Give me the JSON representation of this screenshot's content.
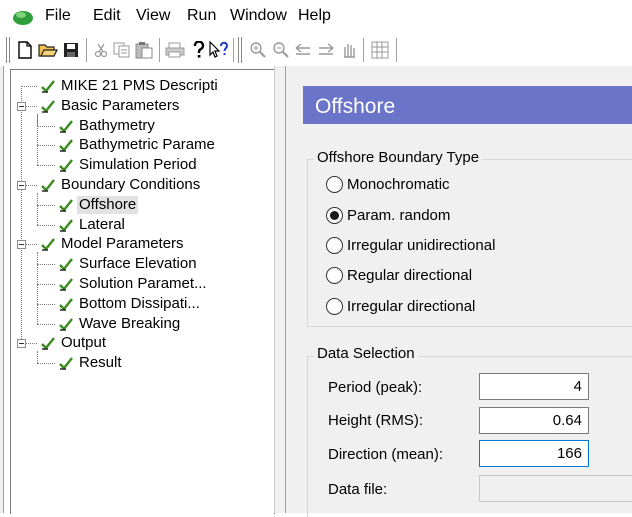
{
  "menu": {
    "items": [
      "File",
      "Edit",
      "View",
      "Run",
      "Window",
      "Help"
    ]
  },
  "toolbar": {
    "buttons": [
      "new-icon",
      "open-icon",
      "save-icon",
      "cut-icon",
      "copy-icon",
      "paste-icon",
      "print-icon",
      "help-icon",
      "context-help-icon",
      "zoom-in-icon",
      "zoom-out-icon",
      "back-icon",
      "forward-icon",
      "pan-icon",
      "grid-icon"
    ]
  },
  "tree": {
    "nodes": [
      {
        "label": "MIKE 21 PMS Descripti",
        "level": 0,
        "checked": true
      },
      {
        "label": "Basic Parameters",
        "level": 0,
        "checked": true,
        "expanded": true
      },
      {
        "label": "Bathymetry",
        "level": 1,
        "checked": true
      },
      {
        "label": "Bathymetric Parame",
        "level": 1,
        "checked": true
      },
      {
        "label": "Simulation Period",
        "level": 1,
        "checked": true
      },
      {
        "label": "Boundary Conditions",
        "level": 0,
        "checked": true,
        "expanded": true
      },
      {
        "label": "Offshore",
        "level": 1,
        "checked": true,
        "selected": true
      },
      {
        "label": "Lateral",
        "level": 1,
        "checked": true
      },
      {
        "label": "Model Parameters",
        "level": 0,
        "checked": true,
        "expanded": true
      },
      {
        "label": "Surface Elevation",
        "level": 1,
        "checked": true
      },
      {
        "label": "Solution Paramet...",
        "level": 1,
        "checked": true
      },
      {
        "label": "Bottom Dissipati...",
        "level": 1,
        "checked": true
      },
      {
        "label": "Wave Breaking",
        "level": 1,
        "checked": true
      },
      {
        "label": "Output",
        "level": 0,
        "checked": true,
        "expanded": true
      },
      {
        "label": "Result",
        "level": 1,
        "checked": true
      }
    ]
  },
  "page": {
    "title": "Offshore"
  },
  "boundary_type": {
    "caption": "Offshore Boundary Type",
    "options": [
      {
        "label": "Monochromatic",
        "selected": false
      },
      {
        "label": "Param. random",
        "selected": true
      },
      {
        "label": "Irregular unidirectional",
        "selected": false
      },
      {
        "label": "Regular directional",
        "selected": false
      },
      {
        "label": "Irregular directional",
        "selected": false
      }
    ]
  },
  "data_selection": {
    "caption": "Data Selection",
    "fields": [
      {
        "label": "Period  (peak):",
        "value": "4"
      },
      {
        "label": "Height  (RMS):",
        "value": "0.64"
      },
      {
        "label": "Direction  (mean):",
        "value": "166"
      },
      {
        "label": "Data file:",
        "value": ""
      }
    ]
  },
  "colors": {
    "title_bar": "#6a74c8",
    "check": "#3a8a1e",
    "focus_border": "#0078d7"
  }
}
